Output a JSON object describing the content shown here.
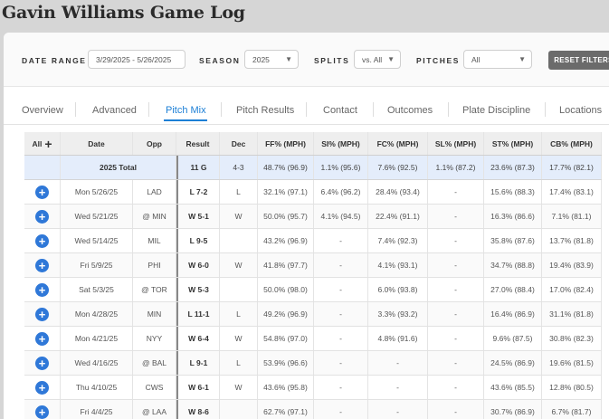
{
  "title": "Gavin Williams Game Log",
  "filters": {
    "date_range_label": "DATE RANGE",
    "date_range_value": "3/29/2025 - 5/26/2025",
    "season_label": "SEASON",
    "season_value": "2025",
    "splits_label": "SPLITS",
    "splits_value": "vs. All",
    "pitches_label": "PITCHES",
    "pitches_value": "All",
    "reset_label": "RESET FILTERS"
  },
  "tabs": [
    "Overview",
    "Advanced",
    "Pitch Mix",
    "Pitch Results",
    "Contact",
    "Outcomes",
    "Plate Discipline",
    "Locations"
  ],
  "active_tab": "Pitch Mix",
  "table": {
    "all_label": "All",
    "columns": [
      "Date",
      "Opp",
      "Result",
      "Dec",
      "FF% (MPH)",
      "SI% (MPH)",
      "FC% (MPH)",
      "SL% (MPH)",
      "ST% (MPH)",
      "CB% (MPH)"
    ],
    "total": {
      "label": "2025 Total",
      "result": "11 G",
      "dec": "4-3",
      "ff": "48.7% (96.9)",
      "si": "1.1% (95.6)",
      "fc": "7.6% (92.5)",
      "sl": "1.1% (87.2)",
      "st": "23.6% (87.3)",
      "cb": "17.7% (82.1)"
    },
    "rows": [
      {
        "date": "Mon 5/26/25",
        "opp": "LAD",
        "result": "L 7-2",
        "dec": "L",
        "ff": "32.1% (97.1)",
        "si": "6.4% (96.2)",
        "fc": "28.4% (93.4)",
        "sl": "-",
        "st": "15.6% (88.3)",
        "cb": "17.4% (83.1)"
      },
      {
        "date": "Wed 5/21/25",
        "opp": "@ MIN",
        "result": "W 5-1",
        "dec": "W",
        "ff": "50.0% (95.7)",
        "si": "4.1% (94.5)",
        "fc": "22.4% (91.1)",
        "sl": "-",
        "st": "16.3% (86.6)",
        "cb": "7.1% (81.1)"
      },
      {
        "date": "Wed 5/14/25",
        "opp": "MIL",
        "result": "L 9-5",
        "dec": "",
        "ff": "43.2% (96.9)",
        "si": "-",
        "fc": "7.4% (92.3)",
        "sl": "-",
        "st": "35.8% (87.6)",
        "cb": "13.7% (81.8)"
      },
      {
        "date": "Fri 5/9/25",
        "opp": "PHI",
        "result": "W 6-0",
        "dec": "W",
        "ff": "41.8% (97.7)",
        "si": "-",
        "fc": "4.1% (93.1)",
        "sl": "-",
        "st": "34.7% (88.8)",
        "cb": "19.4% (83.9)"
      },
      {
        "date": "Sat 5/3/25",
        "opp": "@ TOR",
        "result": "W 5-3",
        "dec": "",
        "ff": "50.0% (98.0)",
        "si": "-",
        "fc": "6.0% (93.8)",
        "sl": "-",
        "st": "27.0% (88.4)",
        "cb": "17.0% (82.4)"
      },
      {
        "date": "Mon 4/28/25",
        "opp": "MIN",
        "result": "L 11-1",
        "dec": "L",
        "ff": "49.2% (96.9)",
        "si": "-",
        "fc": "3.3% (93.2)",
        "sl": "-",
        "st": "16.4% (86.9)",
        "cb": "31.1% (81.8)"
      },
      {
        "date": "Mon 4/21/25",
        "opp": "NYY",
        "result": "W 6-4",
        "dec": "W",
        "ff": "54.8% (97.0)",
        "si": "-",
        "fc": "4.8% (91.6)",
        "sl": "-",
        "st": "9.6% (87.5)",
        "cb": "30.8% (82.3)"
      },
      {
        "date": "Wed 4/16/25",
        "opp": "@ BAL",
        "result": "L 9-1",
        "dec": "L",
        "ff": "53.9% (96.6)",
        "si": "-",
        "fc": "-",
        "sl": "-",
        "st": "24.5% (86.9)",
        "cb": "19.6% (81.5)"
      },
      {
        "date": "Thu 4/10/25",
        "opp": "CWS",
        "result": "W 6-1",
        "dec": "W",
        "ff": "43.6% (95.8)",
        "si": "-",
        "fc": "-",
        "sl": "-",
        "st": "43.6% (85.5)",
        "cb": "12.8% (80.5)"
      },
      {
        "date": "Fri 4/4/25",
        "opp": "@ LAA",
        "result": "W 8-6",
        "dec": "",
        "ff": "62.7% (97.1)",
        "si": "-",
        "fc": "-",
        "sl": "-",
        "st": "30.7% (86.9)",
        "cb": "6.7% (81.7)"
      }
    ]
  }
}
